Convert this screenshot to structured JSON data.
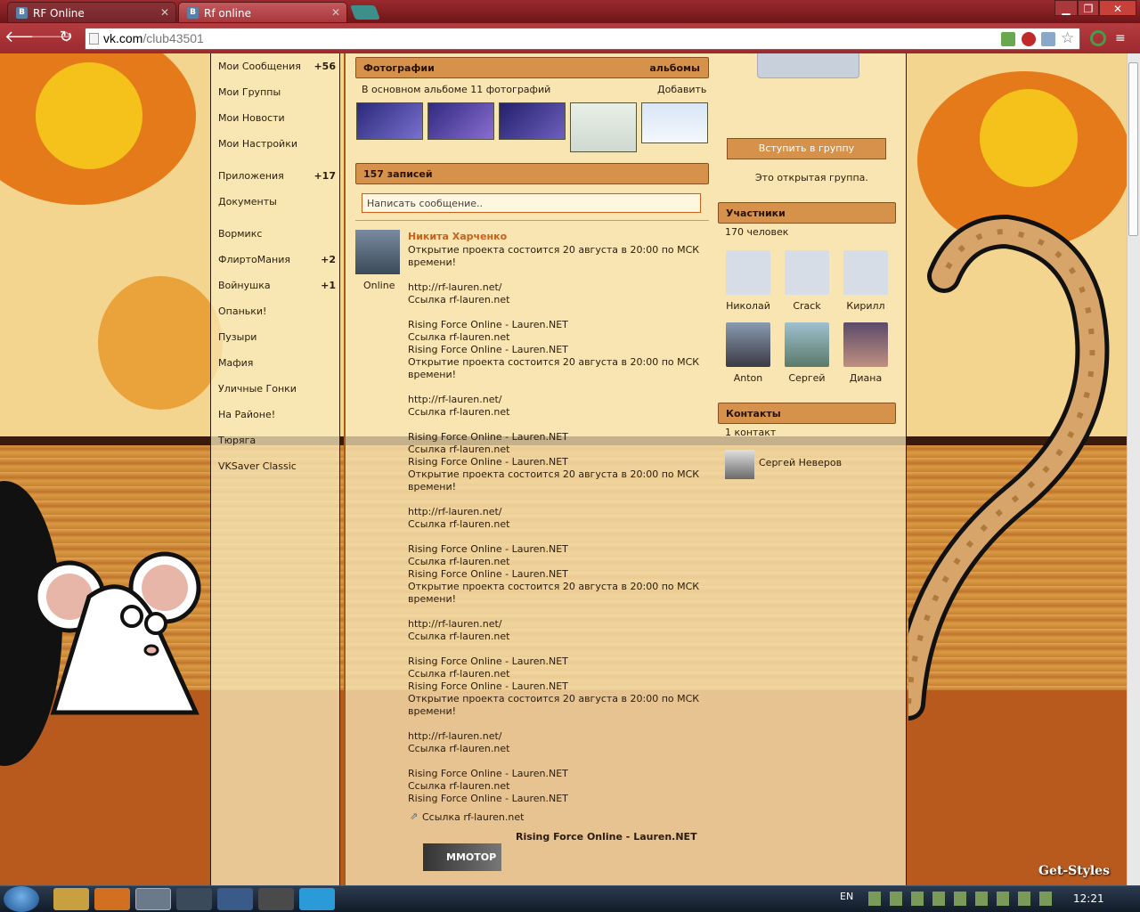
{
  "browser": {
    "tabs": [
      {
        "label": "RF Online",
        "icon": "vk-icon"
      },
      {
        "label": "Rf online",
        "icon": "vk-icon"
      }
    ],
    "url_host": "vk.com",
    "url_path": "/club43501",
    "window_buttons": {
      "min": "▁",
      "max": "❐",
      "close": "✕"
    },
    "nav": {
      "back": "🡐",
      "forward": "🡒",
      "reload": "↻"
    }
  },
  "left_menu": [
    {
      "label": "Мои Сообщения",
      "count": "+56"
    },
    {
      "label": "Мои Группы",
      "count": ""
    },
    {
      "label": "Мои Новости",
      "count": ""
    },
    {
      "label": "Мои Настройки",
      "count": ""
    },
    {
      "label": "Приложения",
      "count": "+17"
    },
    {
      "label": "Документы",
      "count": ""
    },
    {
      "label": "Вормикс",
      "count": ""
    },
    {
      "label": "ФлиртоМания",
      "count": "+2"
    },
    {
      "label": "Войнушка",
      "count": "+1"
    },
    {
      "label": "Опаньки!",
      "count": ""
    },
    {
      "label": "Пузыри",
      "count": ""
    },
    {
      "label": "Мафия",
      "count": ""
    },
    {
      "label": "Уличные Гонки",
      "count": ""
    },
    {
      "label": "На Районе!",
      "count": ""
    },
    {
      "label": "Тюряга",
      "count": ""
    },
    {
      "label": "VKSaver Classic",
      "count": ""
    }
  ],
  "photos": {
    "header": "Фотографии",
    "albums_link": "альбомы",
    "summary": "В основном альбоме 11 фотографий",
    "add_link": "Добавить"
  },
  "wall": {
    "count_header": "157 записей",
    "compose_placeholder": "Написать сообщение..",
    "author": "Никита Харченко",
    "author_status": "Online",
    "lines": [
      "Открытие проекта состоится 20 августа в 20:00 по МСК",
      "времени!",
      "",
      "http://rf-lauren.net/",
      "Ссылка rf-lauren.net",
      "",
      "Rising Force Online - Lauren.NET",
      "Ссылка rf-lauren.net",
      "Rising Force Online - Lauren.NET",
      "Открытие проекта состоится 20 августа в 20:00 по МСК",
      "времени!",
      "",
      "http://rf-lauren.net/",
      "Ссылка rf-lauren.net",
      "",
      "Rising Force Online - Lauren.NET",
      "Ссылка rf-lauren.net",
      "Rising Force Online - Lauren.NET",
      "Открытие проекта состоится 20 августа в 20:00 по МСК",
      "времени!",
      "",
      "http://rf-lauren.net/",
      "Ссылка rf-lauren.net",
      "",
      "Rising Force Online - Lauren.NET",
      "Ссылка rf-lauren.net",
      "Rising Force Online - Lauren.NET",
      "Открытие проекта состоится 20 августа в 20:00 по МСК",
      "времени!",
      "",
      "http://rf-lauren.net/",
      "Ссылка rf-lauren.net",
      "",
      "Rising Force Online - Lauren.NET",
      "Ссылка rf-lauren.net",
      "Rising Force Online - Lauren.NET",
      "Открытие проекта состоится 20 августа в 20:00 по МСК",
      "времени!",
      "",
      "http://rf-lauren.net/",
      "Ссылка rf-lauren.net",
      "",
      "Rising Force Online - Lauren.NET",
      "Ссылка rf-lauren.net",
      "Rising Force Online - Lauren.NET"
    ],
    "attachment_link": "Ссылка rf-lauren.net",
    "attachment_title": "Rising Force Online - Lauren.NET",
    "banner_text": "MMOTOP"
  },
  "right": {
    "join_button": "Вступить в группу",
    "open_group": "Это открытая группа.",
    "members_header": "Участники",
    "members_count": "170 человек",
    "members": [
      {
        "name": "Николай",
        "avatar": "deactivated-dog"
      },
      {
        "name": "Crack",
        "avatar": "camera-placeholder"
      },
      {
        "name": "Кирилл",
        "avatar": "deactivated-dog"
      },
      {
        "name": "Anton",
        "avatar": "photo"
      },
      {
        "name": "Сергей",
        "avatar": "photo"
      },
      {
        "name": "Диана",
        "avatar": "photo"
      }
    ],
    "contacts_header": "Контакты",
    "contacts_count": "1 контакт",
    "contact_name": "Сергей Неверов"
  },
  "taskbar": {
    "lang": "EN",
    "time": "12:21"
  },
  "watermark": "Get-Styles",
  "colors": {
    "header_bg": "#d6924a",
    "author_link": "#c8601a",
    "chrome_red": "#9b2a2e"
  }
}
